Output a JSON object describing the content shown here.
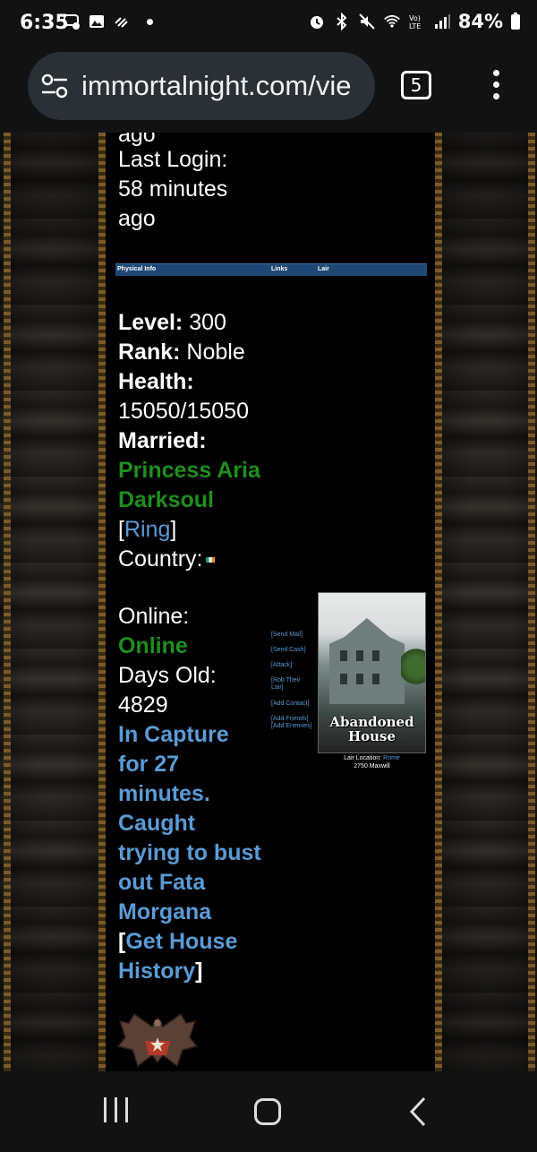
{
  "status_bar": {
    "time": "6:35",
    "battery": "84%",
    "left_icons": [
      "chat-notification-icon",
      "image-icon",
      "stylus-icon",
      "dot-icon"
    ],
    "right_icons": [
      "alarm-icon",
      "bluetooth-icon",
      "mute-icon",
      "wifi-icon",
      "volte-icon",
      "signal-icon",
      "battery-icon"
    ]
  },
  "browser": {
    "url": "immortalnight.com/vie",
    "tab_count": "5"
  },
  "profile": {
    "partial_top": "ago",
    "last_login_label": "Last Login:",
    "last_login_value_1": "58 minutes",
    "last_login_value_2": "ago",
    "tabs": [
      "Physical Info",
      "Links",
      "Lair"
    ],
    "level_label": "Level:",
    "level_value": "300",
    "rank_label": "Rank:",
    "rank_value": "Noble",
    "health_label": "Health:",
    "health_value": "15050/15050",
    "married_label": "Married:",
    "spouse_line1": "Princess Aria",
    "spouse_line2": "Darksoul",
    "ring_open": "[",
    "ring_link": "Ring",
    "ring_close": "]",
    "country_label": "Country:",
    "online_label": "Online:",
    "online_value": "Online",
    "days_old_label": "Days Old:",
    "days_old_value": "4829",
    "capture_lines": [
      "In Capture",
      "for 27",
      "minutes.",
      "Caught",
      "trying to bust",
      "out Fata",
      "Morgana"
    ],
    "history_open": "[",
    "history_link_1": "Get House",
    "history_link_2": "History",
    "history_close": "]"
  },
  "actions": {
    "send_mail": "[Send Mail]",
    "send_cash": "[Send Cash]",
    "attack": "[Attack]",
    "rob_1": "[Rob Their",
    "rob_2": "Lair]",
    "add_contact": "[Add Contact]",
    "add_friends": "[Add Friends]",
    "add_enemies": "[Add Enemies]"
  },
  "lair": {
    "title_1": "Abandoned",
    "title_2": "House",
    "location_label": "Lair Location:",
    "location_city": "Rome",
    "location_address": "2750 Maxwill"
  },
  "colors": {
    "green": "#1f8f1f",
    "link_blue": "#5b9bd5",
    "tabbar": "#1e4774"
  }
}
